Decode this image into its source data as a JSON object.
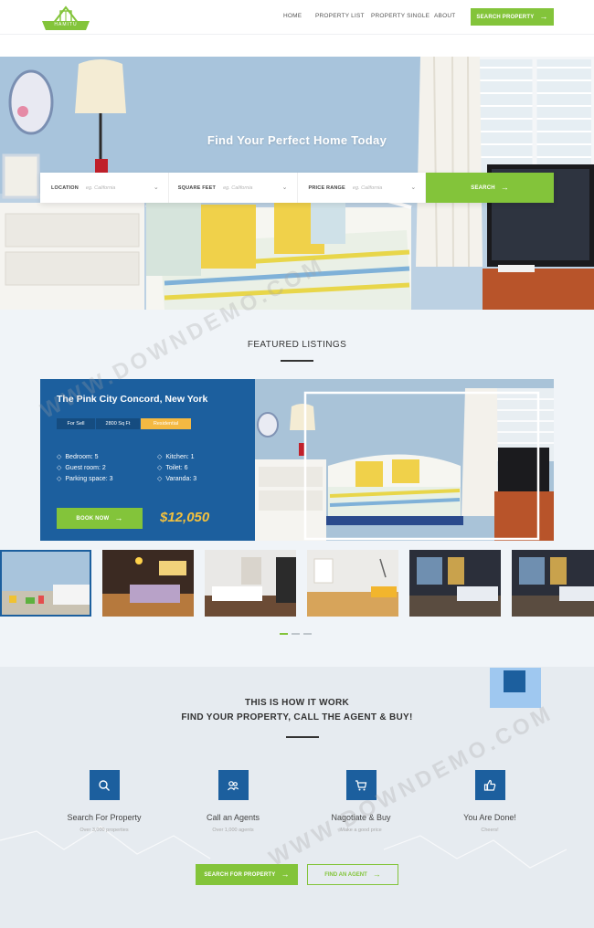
{
  "header": {
    "logo_text": "HAMITU",
    "nav": [
      "HOME",
      "PROPERTY LIST",
      "PROPERTY SINGLE",
      "ABOUT"
    ],
    "cta_label": "SEARCH PROPERTY"
  },
  "hero": {
    "title": "Find Your Perfect Home Today",
    "search": {
      "location_label": "LOCATION",
      "location_placeholder": "eg. California",
      "sqft_label": "SQUARE FEET",
      "sqft_placeholder": "eg. California",
      "price_label": "PRICE RANGE",
      "price_placeholder": "eg. California",
      "button_label": "SEARCH"
    }
  },
  "featured": {
    "title": "FEATURED LISTINGS",
    "listing": {
      "title": "The Pink City Concord, New York",
      "tags": [
        "For Sell",
        "2800 Sq Ft",
        "Residential"
      ],
      "features_left": [
        "Bedroom: 5",
        "Guest room: 2",
        "Parking space: 3"
      ],
      "features_right": [
        "Kitchen: 1",
        "Toilet: 6",
        "Varanda: 3"
      ],
      "book_label": "BOOK NOW",
      "price": "$12,050"
    },
    "active_thumb": 0,
    "active_dot": 0
  },
  "how": {
    "title_line1": "THIS IS HOW IT WORK",
    "title_line2": "FIND YOUR PROPERTY, CALL THE AGENT & BUY!",
    "steps": [
      {
        "title": "Search For Property",
        "sub": "Over 3,000 properties",
        "icon": "search-icon"
      },
      {
        "title": "Call an Agents",
        "sub": "Over 1,000 agents",
        "icon": "users-icon"
      },
      {
        "title": "Nagotiate & Buy",
        "sub": "Make a good price",
        "icon": "cart-icon"
      },
      {
        "title": "You Are Done!",
        "sub": "Cheers!",
        "icon": "thumbs-up-icon"
      }
    ],
    "btn_primary": "SEARCH FOR PROPERTY",
    "btn_secondary": "FIND AN AGENT"
  },
  "watermark": "WWW.DOWNDEMO.COM",
  "colors": {
    "green": "#83c43a",
    "blue": "#1c5f9e",
    "gold": "#f4c13d"
  }
}
